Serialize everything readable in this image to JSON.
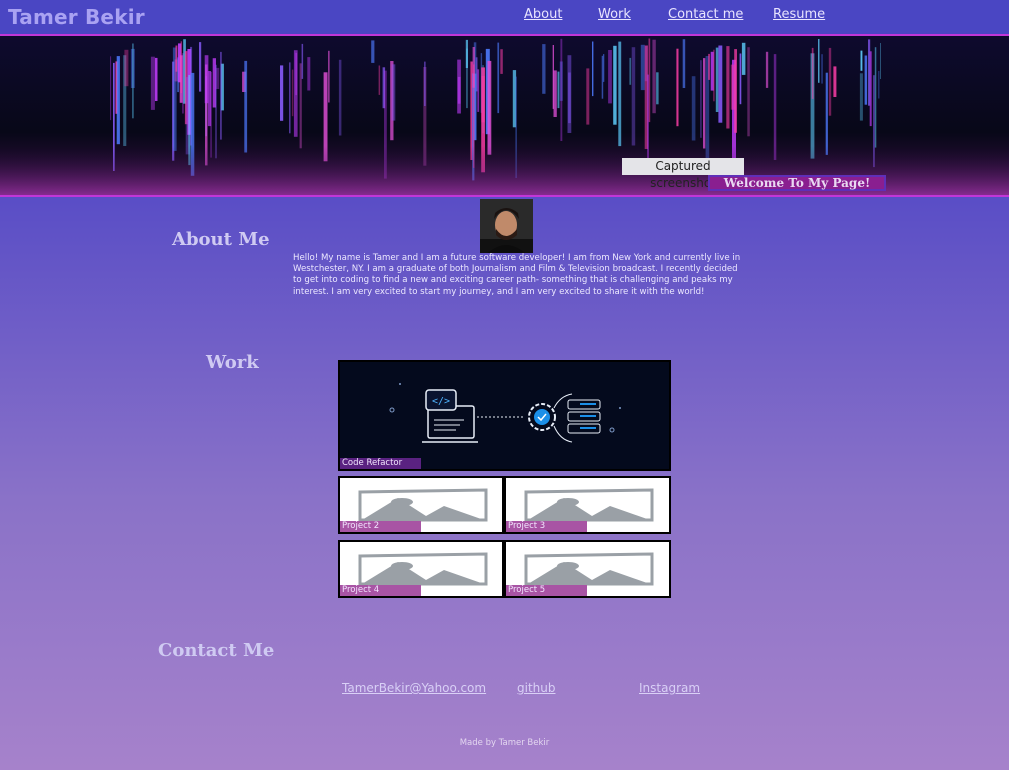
{
  "header": {
    "brand": "Tamer Bekir",
    "nav": [
      "About",
      "Work",
      "Contact me",
      "Resume"
    ]
  },
  "hero": {
    "screenshot_label": "Captured screenshot",
    "welcome": "Welcome To My Page!"
  },
  "about": {
    "title": "About Me",
    "text": "Hello! My name is Tamer and I am a future software developer! I am from New York and currently live in Westchester, NY. I am a graduate of both Journalism and Film & Television broadcast. I recently decided to get into coding to find a new and exciting career path- something that is challenging and peaks my interest. I am very excited to start my journey, and I am very excited to share it with the world!"
  },
  "work": {
    "title": "Work",
    "projects": [
      "Code Refactor",
      "Project 2",
      "Project 3",
      "Project 4",
      "Project 5"
    ]
  },
  "contact": {
    "title": "Contact Me",
    "links": [
      "TamerBekir@Yahoo.com",
      "github",
      "Instagram"
    ]
  },
  "footer": "Made by Tamer Bekir",
  "colors": {
    "accent": "#c236d8",
    "header_bg": "#4a46c3",
    "caption_dark": "#5a2281",
    "caption_pink": "#a854a4"
  }
}
